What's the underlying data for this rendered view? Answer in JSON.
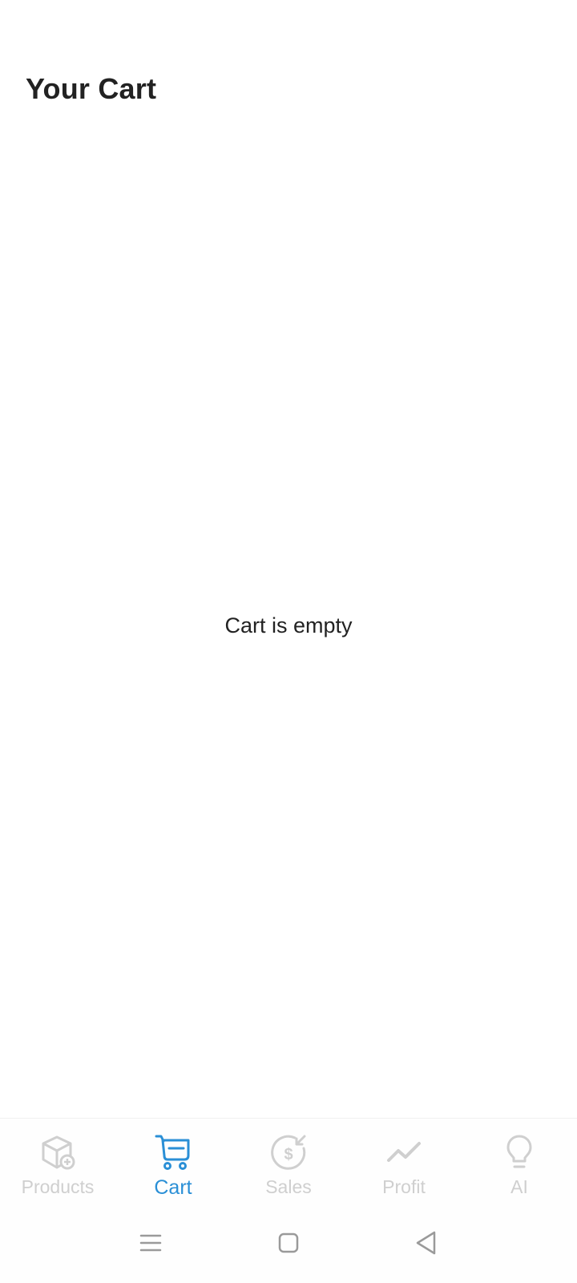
{
  "header": {
    "title": "Your Cart"
  },
  "main": {
    "empty_message": "Cart is empty"
  },
  "bottom_nav": {
    "items": [
      {
        "label": "Products",
        "icon": "product-box-add-icon",
        "active": false
      },
      {
        "label": "Cart",
        "icon": "cart-icon",
        "active": true
      },
      {
        "label": "Sales",
        "icon": "dollar-sales-icon",
        "active": false
      },
      {
        "label": "Profit",
        "icon": "trend-line-icon",
        "active": false
      },
      {
        "label": "AI",
        "icon": "lightbulb-icon",
        "active": false
      }
    ]
  },
  "system_nav": {
    "buttons": [
      "menu-icon",
      "home-icon",
      "back-icon"
    ]
  },
  "colors": {
    "accent": "#2a8fd6",
    "inactive": "#cfcfcf",
    "text": "#222222",
    "background": "#ffffff"
  }
}
